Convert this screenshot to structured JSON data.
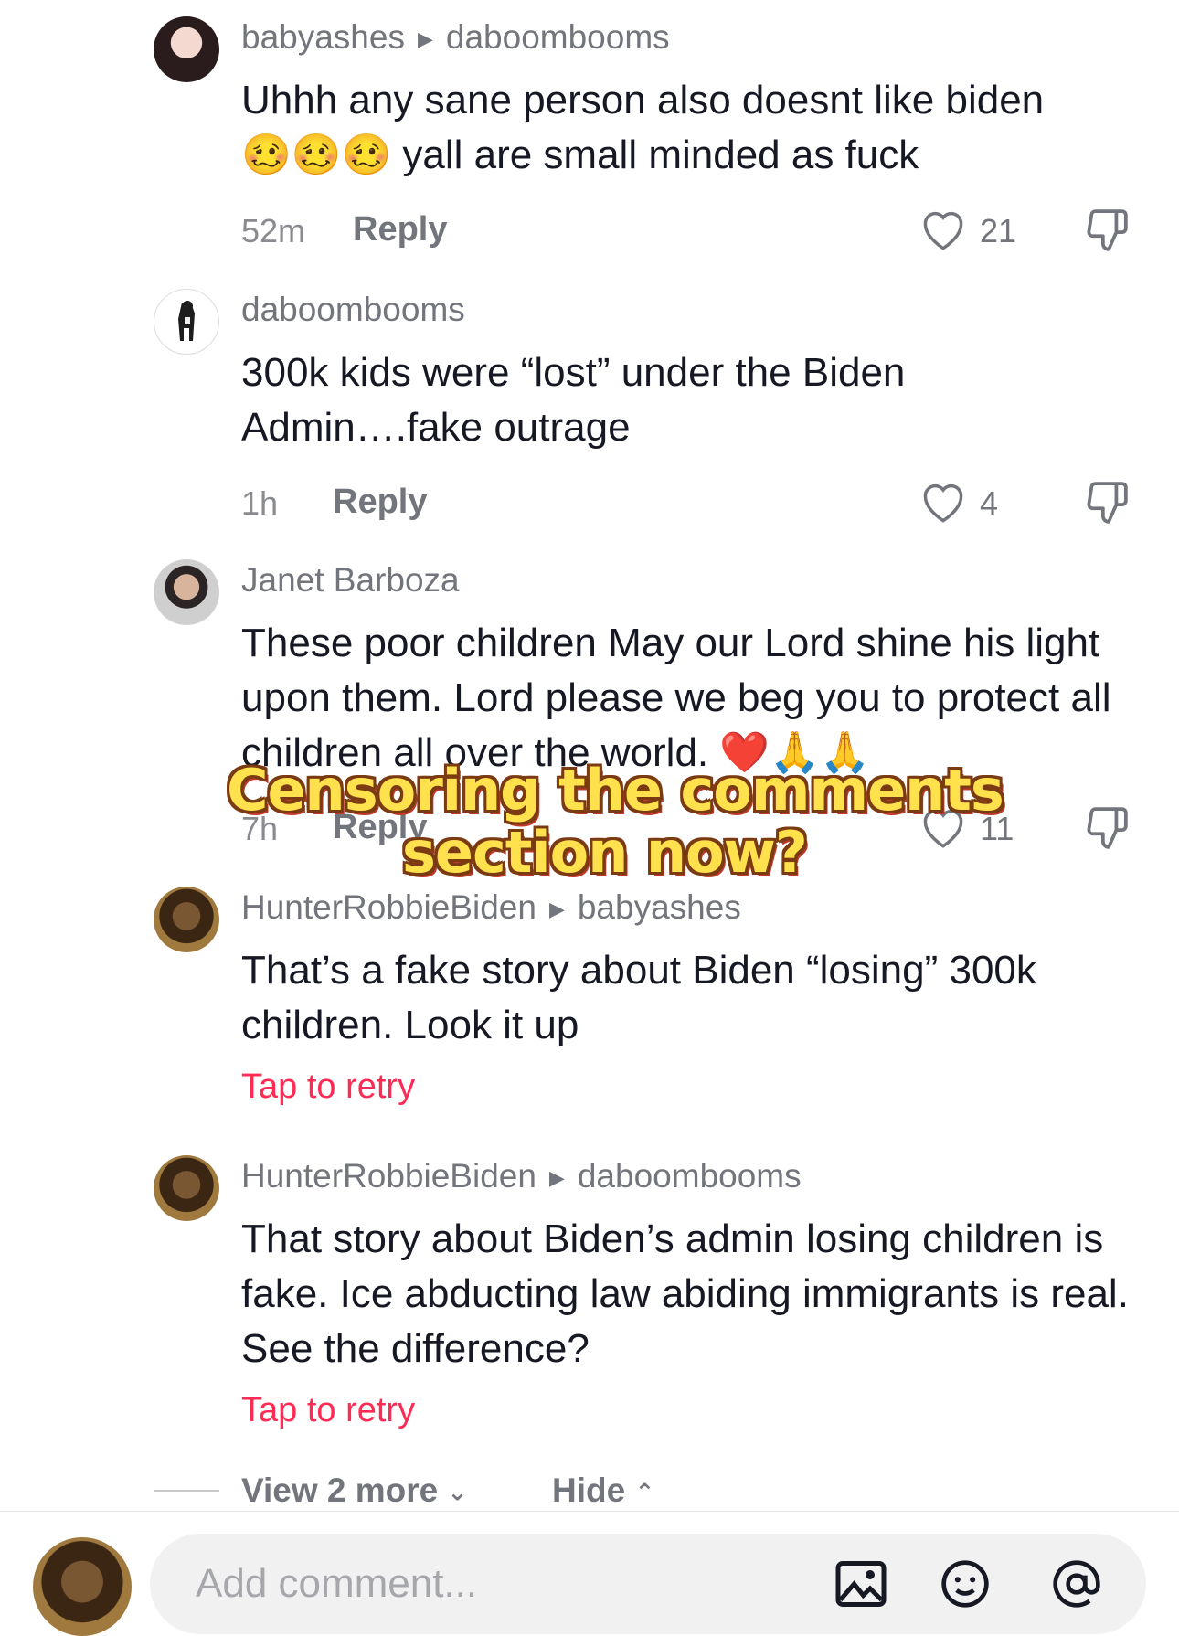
{
  "comments": [
    {
      "username": "babyashes",
      "reply_to": "daboombooms",
      "text_line1": "Uhhh any sane person also doesnt like biden",
      "text_line2": "yall are small minded as fuck",
      "emoji": "🥴🥴🥴",
      "time": "52m",
      "reply_label": "Reply",
      "likes": "21"
    },
    {
      "username": "daboombooms",
      "text": "300k kids were “lost” under the Biden Admin….fake outrage",
      "time": "1h",
      "reply_label": "Reply",
      "likes": "4"
    },
    {
      "username": "Janet Barboza",
      "text": "These poor children May our Lord shine his light upon them. Lord please we beg you to protect all children all over the world.",
      "emoji": "❤️🙏🙏",
      "time": "7h",
      "reply_label": "Reply",
      "likes": "11"
    },
    {
      "username": "HunterRobbieBiden",
      "reply_to": "babyashes",
      "text": "That’s a fake story about Biden “losing” 300k children. Look it up",
      "status": "Tap to retry"
    },
    {
      "username": "HunterRobbieBiden",
      "reply_to": "daboombooms",
      "text": "That story about Biden’s admin losing children is fake. Ice abducting law abiding immigrants is real. See the difference?",
      "status": "Tap to retry"
    }
  ],
  "overlay_caption": {
    "line1": "Censoring the comments",
    "line2": "section now?"
  },
  "thread_controls": {
    "view_more": "View 2 more",
    "hide": "Hide"
  },
  "composer": {
    "placeholder": "Add comment..."
  },
  "colors": {
    "retry": "#fe2c55",
    "caption_fill": "#ffe14d",
    "caption_stroke": "#7a3a12"
  }
}
